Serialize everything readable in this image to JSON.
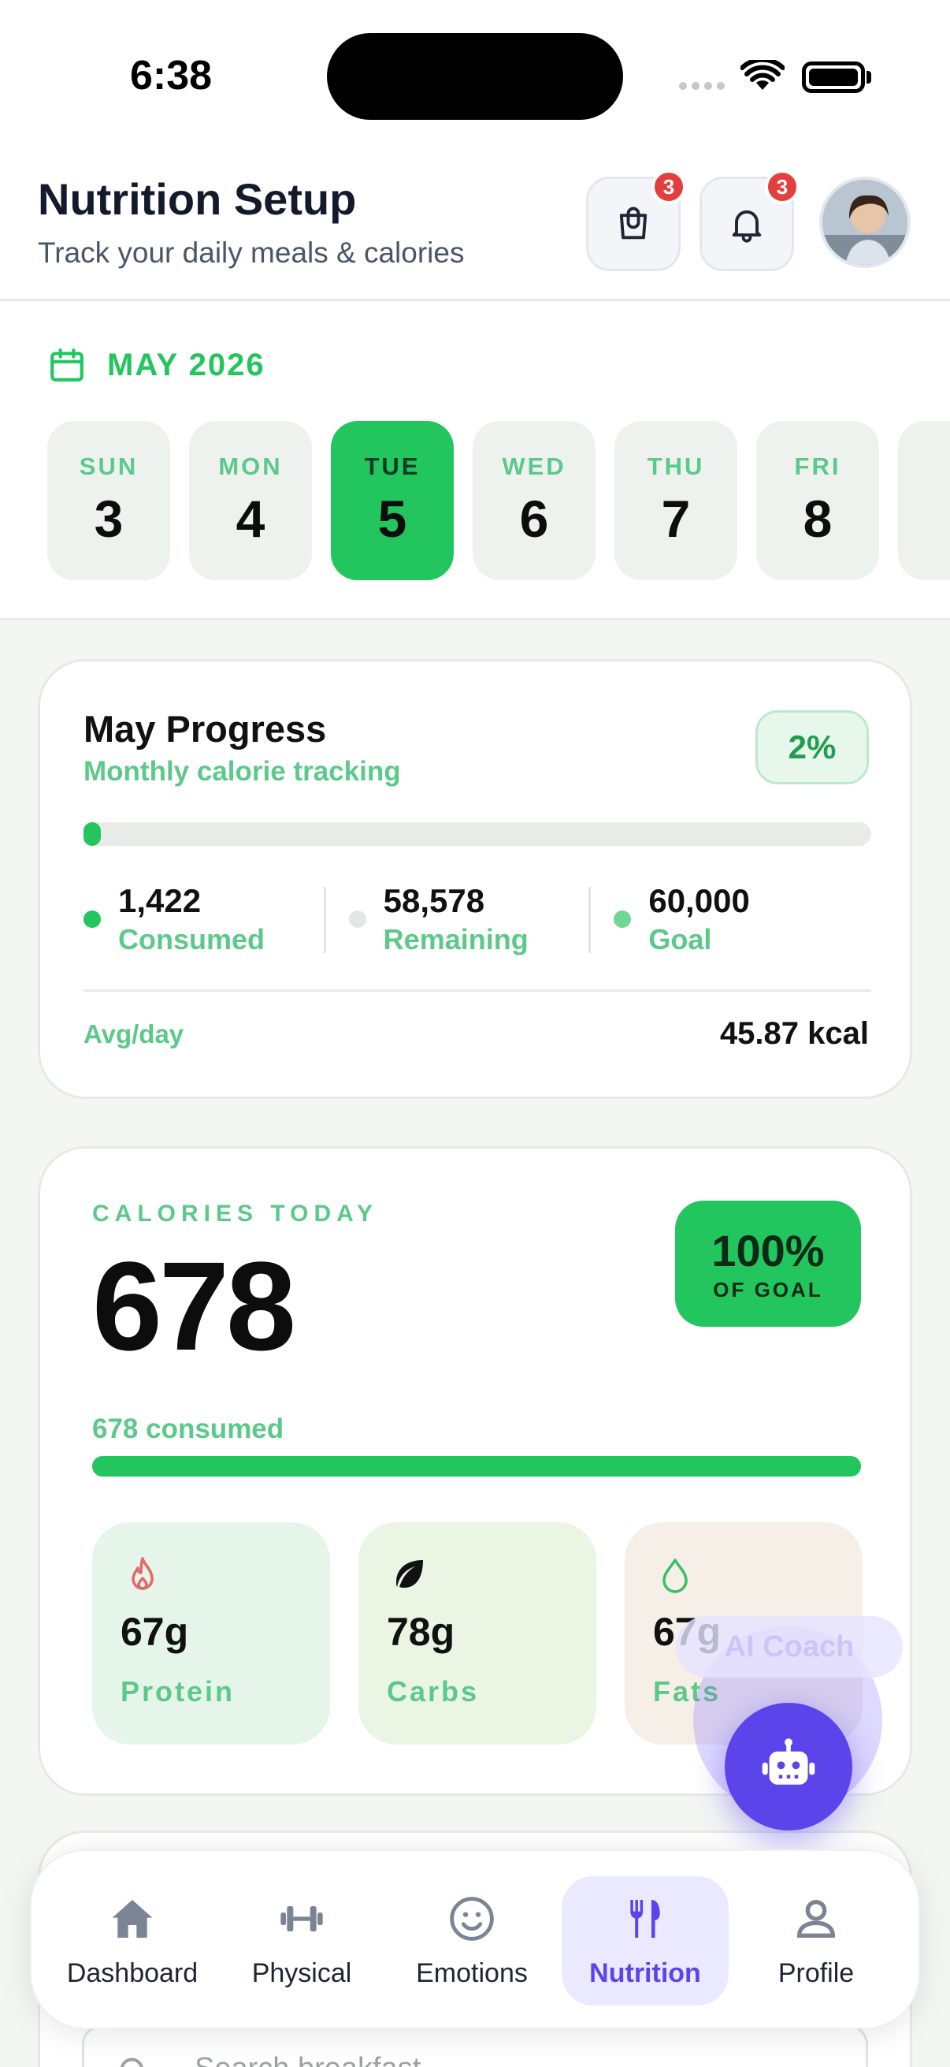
{
  "status_bar": {
    "time": "6:38"
  },
  "header": {
    "title": "Nutrition Setup",
    "subtitle": "Track your daily meals & calories",
    "cart_badge": "3",
    "notifications_badge": "3"
  },
  "calendar": {
    "month": "MAY 2026",
    "days": [
      {
        "dow": "SUN",
        "num": "3"
      },
      {
        "dow": "MON",
        "num": "4"
      },
      {
        "dow": "TUE",
        "num": "5",
        "selected": true
      },
      {
        "dow": "WED",
        "num": "6"
      },
      {
        "dow": "THU",
        "num": "7"
      },
      {
        "dow": "FRI",
        "num": "8"
      }
    ]
  },
  "monthly_progress": {
    "title": "May Progress",
    "subtitle": "Monthly calorie tracking",
    "percent_label": "2%",
    "progress_fraction": 0.02,
    "consumed": {
      "value": "1,422",
      "label": "Consumed"
    },
    "remaining": {
      "value": "58,578",
      "label": "Remaining"
    },
    "goal": {
      "value": "60,000",
      "label": "Goal"
    },
    "avg_label": "Avg/day",
    "avg_value": "45.87 kcal"
  },
  "calories_today": {
    "label": "CALORIES TODAY",
    "value": "678",
    "goal_percent": "100%",
    "goal_label": "OF GOAL",
    "consumed_text": "678 consumed",
    "progress_fraction": 1.0,
    "macros": [
      {
        "value": "67g",
        "label": "Protein",
        "icon": "flame-icon",
        "bg": "#e6f5ea"
      },
      {
        "value": "78g",
        "label": "Carbs",
        "icon": "leaf-icon",
        "bg": "#eaf5e4"
      },
      {
        "value": "67g",
        "label": "Fats",
        "icon": "drop-icon",
        "bg": "#f6efe8"
      }
    ]
  },
  "ai_coach": {
    "label": "AI Coach"
  },
  "search": {
    "placeholder": "Search breakfast"
  },
  "tabbar": {
    "items": [
      {
        "label": "Dashboard",
        "icon": "home-icon"
      },
      {
        "label": "Physical",
        "icon": "dumbbell-icon"
      },
      {
        "label": "Emotions",
        "icon": "smiley-icon"
      },
      {
        "label": "Nutrition",
        "icon": "utensils-icon",
        "active": true
      },
      {
        "label": "Profile",
        "icon": "person-icon"
      }
    ]
  },
  "colors": {
    "accent_green": "#22c55e",
    "light_green_text": "#5cc98a",
    "primary_purple": "#5b45ea",
    "badge_red": "#e53e3e"
  }
}
